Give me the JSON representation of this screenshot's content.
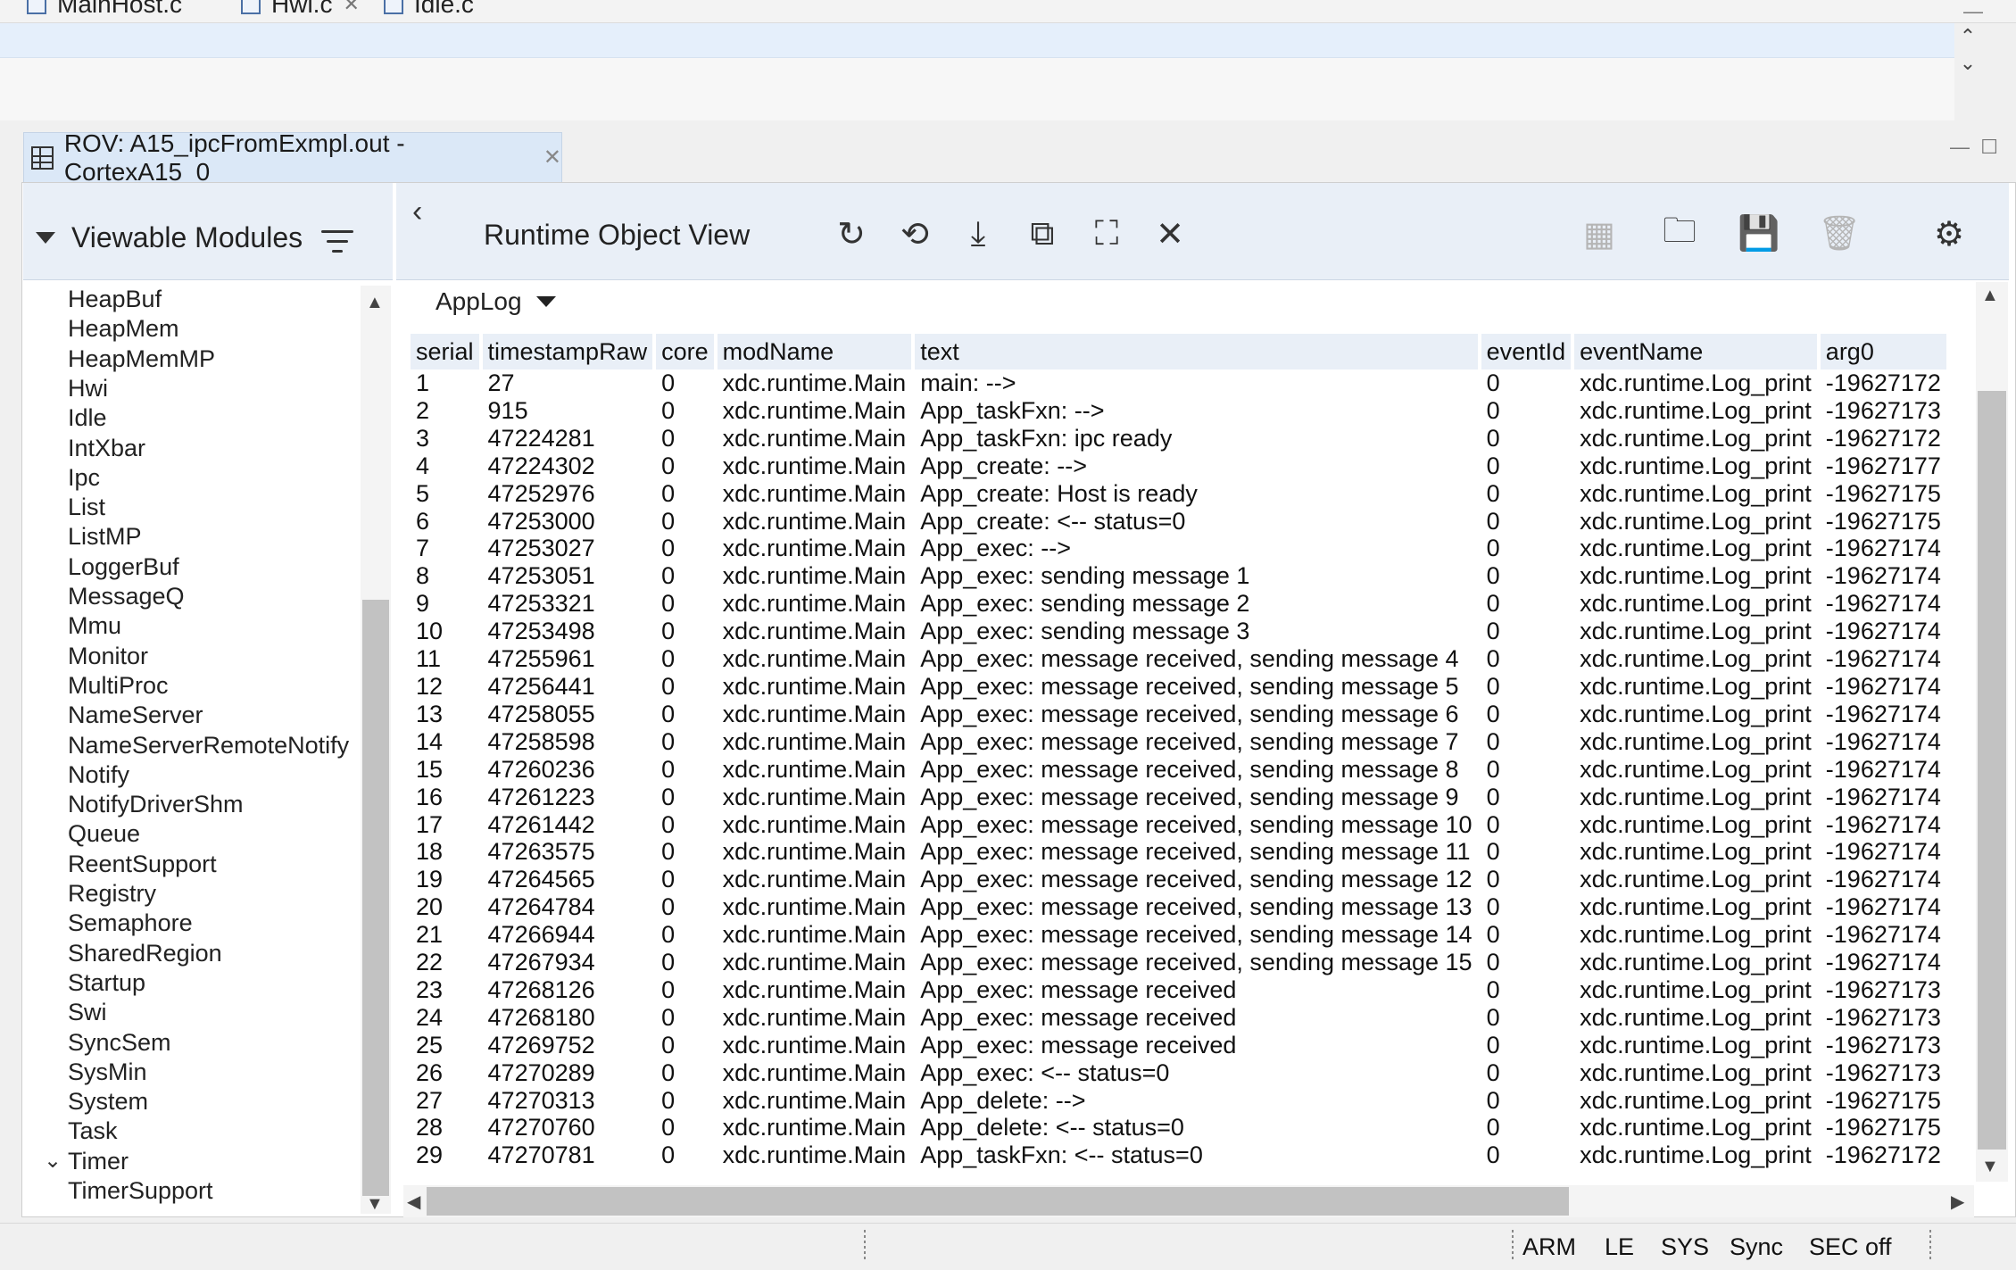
{
  "editor_tabs": [
    {
      "label": "MainHost.c"
    },
    {
      "label": "Hwi.c"
    },
    {
      "label": "Idle.c"
    }
  ],
  "view_tab": {
    "label": "ROV: A15_ipcFromExmpl.out - CortexA15_0"
  },
  "modules_panel": {
    "title": "Viewable Modules",
    "items": [
      "HeapBuf",
      "HeapMem",
      "HeapMemMP",
      "Hwi",
      "Idle",
      "IntXbar",
      "Ipc",
      "List",
      "ListMP",
      "LoggerBuf",
      "MessageQ",
      "Mmu",
      "Monitor",
      "MultiProc",
      "NameServer",
      "NameServerRemoteNotify",
      "Notify",
      "NotifyDriverShm",
      "Queue",
      "ReentSupport",
      "Registry",
      "Semaphore",
      "SharedRegion",
      "Startup",
      "Swi",
      "SyncSem",
      "SysMin",
      "System",
      "Task",
      "Timer",
      "TimerSupport"
    ],
    "expanded_item": "Timer"
  },
  "rov": {
    "title": "Runtime Object View",
    "toolbar_icons": [
      "refresh-icon",
      "continuous-refresh-icon",
      "download-icon",
      "select-all-icon",
      "fullscreen-icon",
      "close-icon"
    ],
    "right_icons": [
      "dashboard-icon",
      "folder-icon",
      "save-icon",
      "trash-icon",
      "settings-icon"
    ],
    "view_selector": "AppLog"
  },
  "table": {
    "columns": [
      "serial",
      "timestampRaw",
      "core",
      "modName",
      "text",
      "eventId",
      "eventName",
      "arg0"
    ],
    "rows": [
      [
        "1",
        "27",
        "0",
        "xdc.runtime.Main",
        "main: -->",
        "0",
        "xdc.runtime.Log_print",
        "-19627172"
      ],
      [
        "2",
        "915",
        "0",
        "xdc.runtime.Main",
        "App_taskFxn: -->",
        "0",
        "xdc.runtime.Log_print",
        "-19627173"
      ],
      [
        "3",
        "47224281",
        "0",
        "xdc.runtime.Main",
        "App_taskFxn: ipc ready",
        "0",
        "xdc.runtime.Log_print",
        "-19627172"
      ],
      [
        "4",
        "47224302",
        "0",
        "xdc.runtime.Main",
        "App_create: -->",
        "0",
        "xdc.runtime.Log_print",
        "-19627177"
      ],
      [
        "5",
        "47252976",
        "0",
        "xdc.runtime.Main",
        "App_create: Host is ready",
        "0",
        "xdc.runtime.Log_print",
        "-19627175"
      ],
      [
        "6",
        "47253000",
        "0",
        "xdc.runtime.Main",
        "App_create: <-- status=0",
        "0",
        "xdc.runtime.Log_print",
        "-19627175"
      ],
      [
        "7",
        "47253027",
        "0",
        "xdc.runtime.Main",
        "App_exec: -->",
        "0",
        "xdc.runtime.Log_print",
        "-19627174"
      ],
      [
        "8",
        "47253051",
        "0",
        "xdc.runtime.Main",
        "App_exec: sending message 1",
        "0",
        "xdc.runtime.Log_print",
        "-19627174"
      ],
      [
        "9",
        "47253321",
        "0",
        "xdc.runtime.Main",
        "App_exec: sending message 2",
        "0",
        "xdc.runtime.Log_print",
        "-19627174"
      ],
      [
        "10",
        "47253498",
        "0",
        "xdc.runtime.Main",
        "App_exec: sending message 3",
        "0",
        "xdc.runtime.Log_print",
        "-19627174"
      ],
      [
        "11",
        "47255961",
        "0",
        "xdc.runtime.Main",
        "App_exec: message received, sending message 4",
        "0",
        "xdc.runtime.Log_print",
        "-19627174"
      ],
      [
        "12",
        "47256441",
        "0",
        "xdc.runtime.Main",
        "App_exec: message received, sending message 5",
        "0",
        "xdc.runtime.Log_print",
        "-19627174"
      ],
      [
        "13",
        "47258055",
        "0",
        "xdc.runtime.Main",
        "App_exec: message received, sending message 6",
        "0",
        "xdc.runtime.Log_print",
        "-19627174"
      ],
      [
        "14",
        "47258598",
        "0",
        "xdc.runtime.Main",
        "App_exec: message received, sending message 7",
        "0",
        "xdc.runtime.Log_print",
        "-19627174"
      ],
      [
        "15",
        "47260236",
        "0",
        "xdc.runtime.Main",
        "App_exec: message received, sending message 8",
        "0",
        "xdc.runtime.Log_print",
        "-19627174"
      ],
      [
        "16",
        "47261223",
        "0",
        "xdc.runtime.Main",
        "App_exec: message received, sending message 9",
        "0",
        "xdc.runtime.Log_print",
        "-19627174"
      ],
      [
        "17",
        "47261442",
        "0",
        "xdc.runtime.Main",
        "App_exec: message received, sending message 10",
        "0",
        "xdc.runtime.Log_print",
        "-19627174"
      ],
      [
        "18",
        "47263575",
        "0",
        "xdc.runtime.Main",
        "App_exec: message received, sending message 11",
        "0",
        "xdc.runtime.Log_print",
        "-19627174"
      ],
      [
        "19",
        "47264565",
        "0",
        "xdc.runtime.Main",
        "App_exec: message received, sending message 12",
        "0",
        "xdc.runtime.Log_print",
        "-19627174"
      ],
      [
        "20",
        "47264784",
        "0",
        "xdc.runtime.Main",
        "App_exec: message received, sending message 13",
        "0",
        "xdc.runtime.Log_print",
        "-19627174"
      ],
      [
        "21",
        "47266944",
        "0",
        "xdc.runtime.Main",
        "App_exec: message received, sending message 14",
        "0",
        "xdc.runtime.Log_print",
        "-19627174"
      ],
      [
        "22",
        "47267934",
        "0",
        "xdc.runtime.Main",
        "App_exec: message received, sending message 15",
        "0",
        "xdc.runtime.Log_print",
        "-19627174"
      ],
      [
        "23",
        "47268126",
        "0",
        "xdc.runtime.Main",
        "App_exec: message received",
        "0",
        "xdc.runtime.Log_print",
        "-19627173"
      ],
      [
        "24",
        "47268180",
        "0",
        "xdc.runtime.Main",
        "App_exec: message received",
        "0",
        "xdc.runtime.Log_print",
        "-19627173"
      ],
      [
        "25",
        "47269752",
        "0",
        "xdc.runtime.Main",
        "App_exec: message received",
        "0",
        "xdc.runtime.Log_print",
        "-19627173"
      ],
      [
        "26",
        "47270289",
        "0",
        "xdc.runtime.Main",
        "App_exec: <-- status=0",
        "0",
        "xdc.runtime.Log_print",
        "-19627173"
      ],
      [
        "27",
        "47270313",
        "0",
        "xdc.runtime.Main",
        "App_delete: -->",
        "0",
        "xdc.runtime.Log_print",
        "-19627175"
      ],
      [
        "28",
        "47270760",
        "0",
        "xdc.runtime.Main",
        "App_delete: <-- status=0",
        "0",
        "xdc.runtime.Log_print",
        "-19627175"
      ],
      [
        "29",
        "47270781",
        "0",
        "xdc.runtime.Main",
        "App_taskFxn: <-- status=0",
        "0",
        "xdc.runtime.Log_print",
        "-19627172"
      ]
    ]
  },
  "status_bar": {
    "items": [
      "ARM",
      "LE",
      "SYS",
      "Sync",
      "SEC off"
    ]
  }
}
